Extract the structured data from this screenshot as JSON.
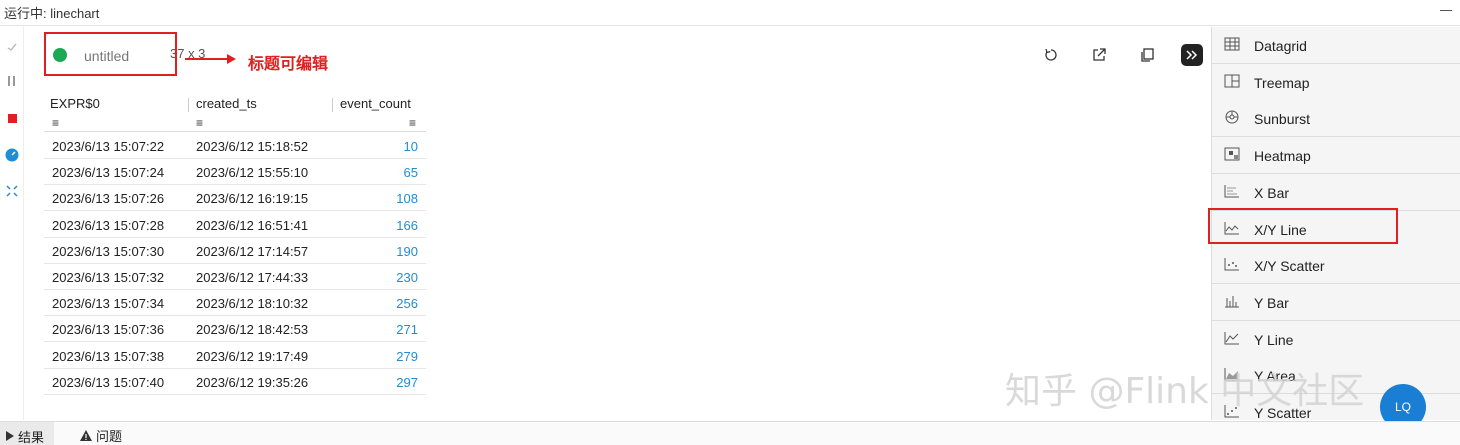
{
  "window": {
    "title": "运行中: linechart"
  },
  "left_toolbar": {
    "icons": [
      "check-icon",
      "pause-icon",
      "stop-icon",
      "dashboard-icon",
      "expand-icon"
    ]
  },
  "result_header": {
    "title": "untitled",
    "dims": "37 x 3",
    "annotation": "标题可编辑",
    "status_color": "#1aaa55"
  },
  "toolbar_icons": [
    "refresh-icon",
    "open-external-icon",
    "copy-icon",
    "collapse-panel-icon"
  ],
  "table": {
    "columns": [
      "EXPR$0",
      "created_ts",
      "event_count"
    ],
    "rows": [
      [
        "2023/6/13 15:07:22",
        "2023/6/12 15:18:52",
        "10"
      ],
      [
        "2023/6/13 15:07:24",
        "2023/6/12 15:55:10",
        "65"
      ],
      [
        "2023/6/13 15:07:26",
        "2023/6/12 16:19:15",
        "108"
      ],
      [
        "2023/6/13 15:07:28",
        "2023/6/12 16:51:41",
        "166"
      ],
      [
        "2023/6/13 15:07:30",
        "2023/6/12 17:14:57",
        "190"
      ],
      [
        "2023/6/13 15:07:32",
        "2023/6/12 17:44:33",
        "230"
      ],
      [
        "2023/6/13 15:07:34",
        "2023/6/12 18:10:32",
        "256"
      ],
      [
        "2023/6/13 15:07:36",
        "2023/6/12 18:42:53",
        "271"
      ],
      [
        "2023/6/13 15:07:38",
        "2023/6/12 19:17:49",
        "279"
      ],
      [
        "2023/6/13 15:07:40",
        "2023/6/12 19:35:26",
        "297"
      ]
    ]
  },
  "viz_panel": {
    "items": [
      {
        "label": "Datagrid",
        "icon": "datagrid-icon"
      },
      {
        "label": "Treemap",
        "icon": "treemap-icon"
      },
      {
        "label": "Sunburst",
        "icon": "sunburst-icon"
      },
      {
        "label": "Heatmap",
        "icon": "heatmap-icon"
      },
      {
        "label": "X Bar",
        "icon": "x-bar-icon"
      },
      {
        "label": "X/Y Line",
        "icon": "xy-line-icon",
        "highlighted": true
      },
      {
        "label": "X/Y Scatter",
        "icon": "xy-scatter-icon"
      },
      {
        "label": "Y Bar",
        "icon": "y-bar-icon"
      },
      {
        "label": "Y Line",
        "icon": "y-line-icon"
      },
      {
        "label": "Y Area",
        "icon": "y-area-icon"
      },
      {
        "label": "Y Scatter",
        "icon": "y-scatter-icon"
      }
    ]
  },
  "watermark": "知乎 @Flink 中文社区",
  "fab": {
    "label": "LQ"
  },
  "bottom_tabs": [
    {
      "label": "结果",
      "active": true
    },
    {
      "label": "问题",
      "active": false
    }
  ],
  "colors": {
    "accent": "#1f8dd6",
    "annotation": "#e02020",
    "status_ok": "#1aaa55"
  }
}
